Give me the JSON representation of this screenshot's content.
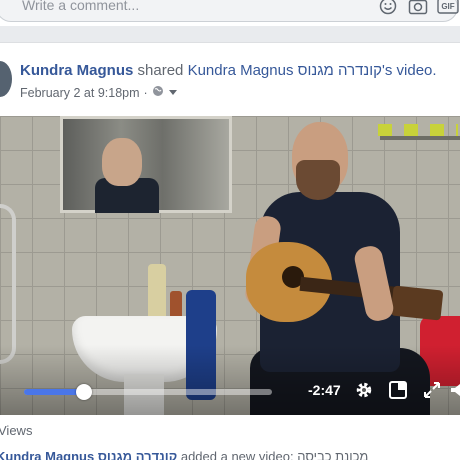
{
  "comment_bar": {
    "placeholder": "Write a comment...",
    "icons": [
      "emoji-icon",
      "camera-icon",
      "gif-icon"
    ],
    "gif_label": "GIF"
  },
  "post": {
    "author": "Kundra Magnus",
    "action": "shared",
    "source_name": "Kundra Magnus קונדרה מגנוס",
    "source_suffix": "'s video.",
    "date": "February 2 at 9:18pm",
    "separator": "·",
    "audience_icon": "globe-icon"
  },
  "video": {
    "progress_fraction": 0.24,
    "time_remaining": "-2:47",
    "controls": [
      "settings-icon",
      "mini-player-icon",
      "fullscreen-icon",
      "volume-icon"
    ]
  },
  "footer": {
    "views": "Views",
    "shared_by": "Kundra Magnus קונדרה מגנוס",
    "shared_action": "added a new video: מכונת כביסה"
  },
  "colors": {
    "link": "#365899",
    "meta": "#616770",
    "progress": "#4a76e8"
  }
}
